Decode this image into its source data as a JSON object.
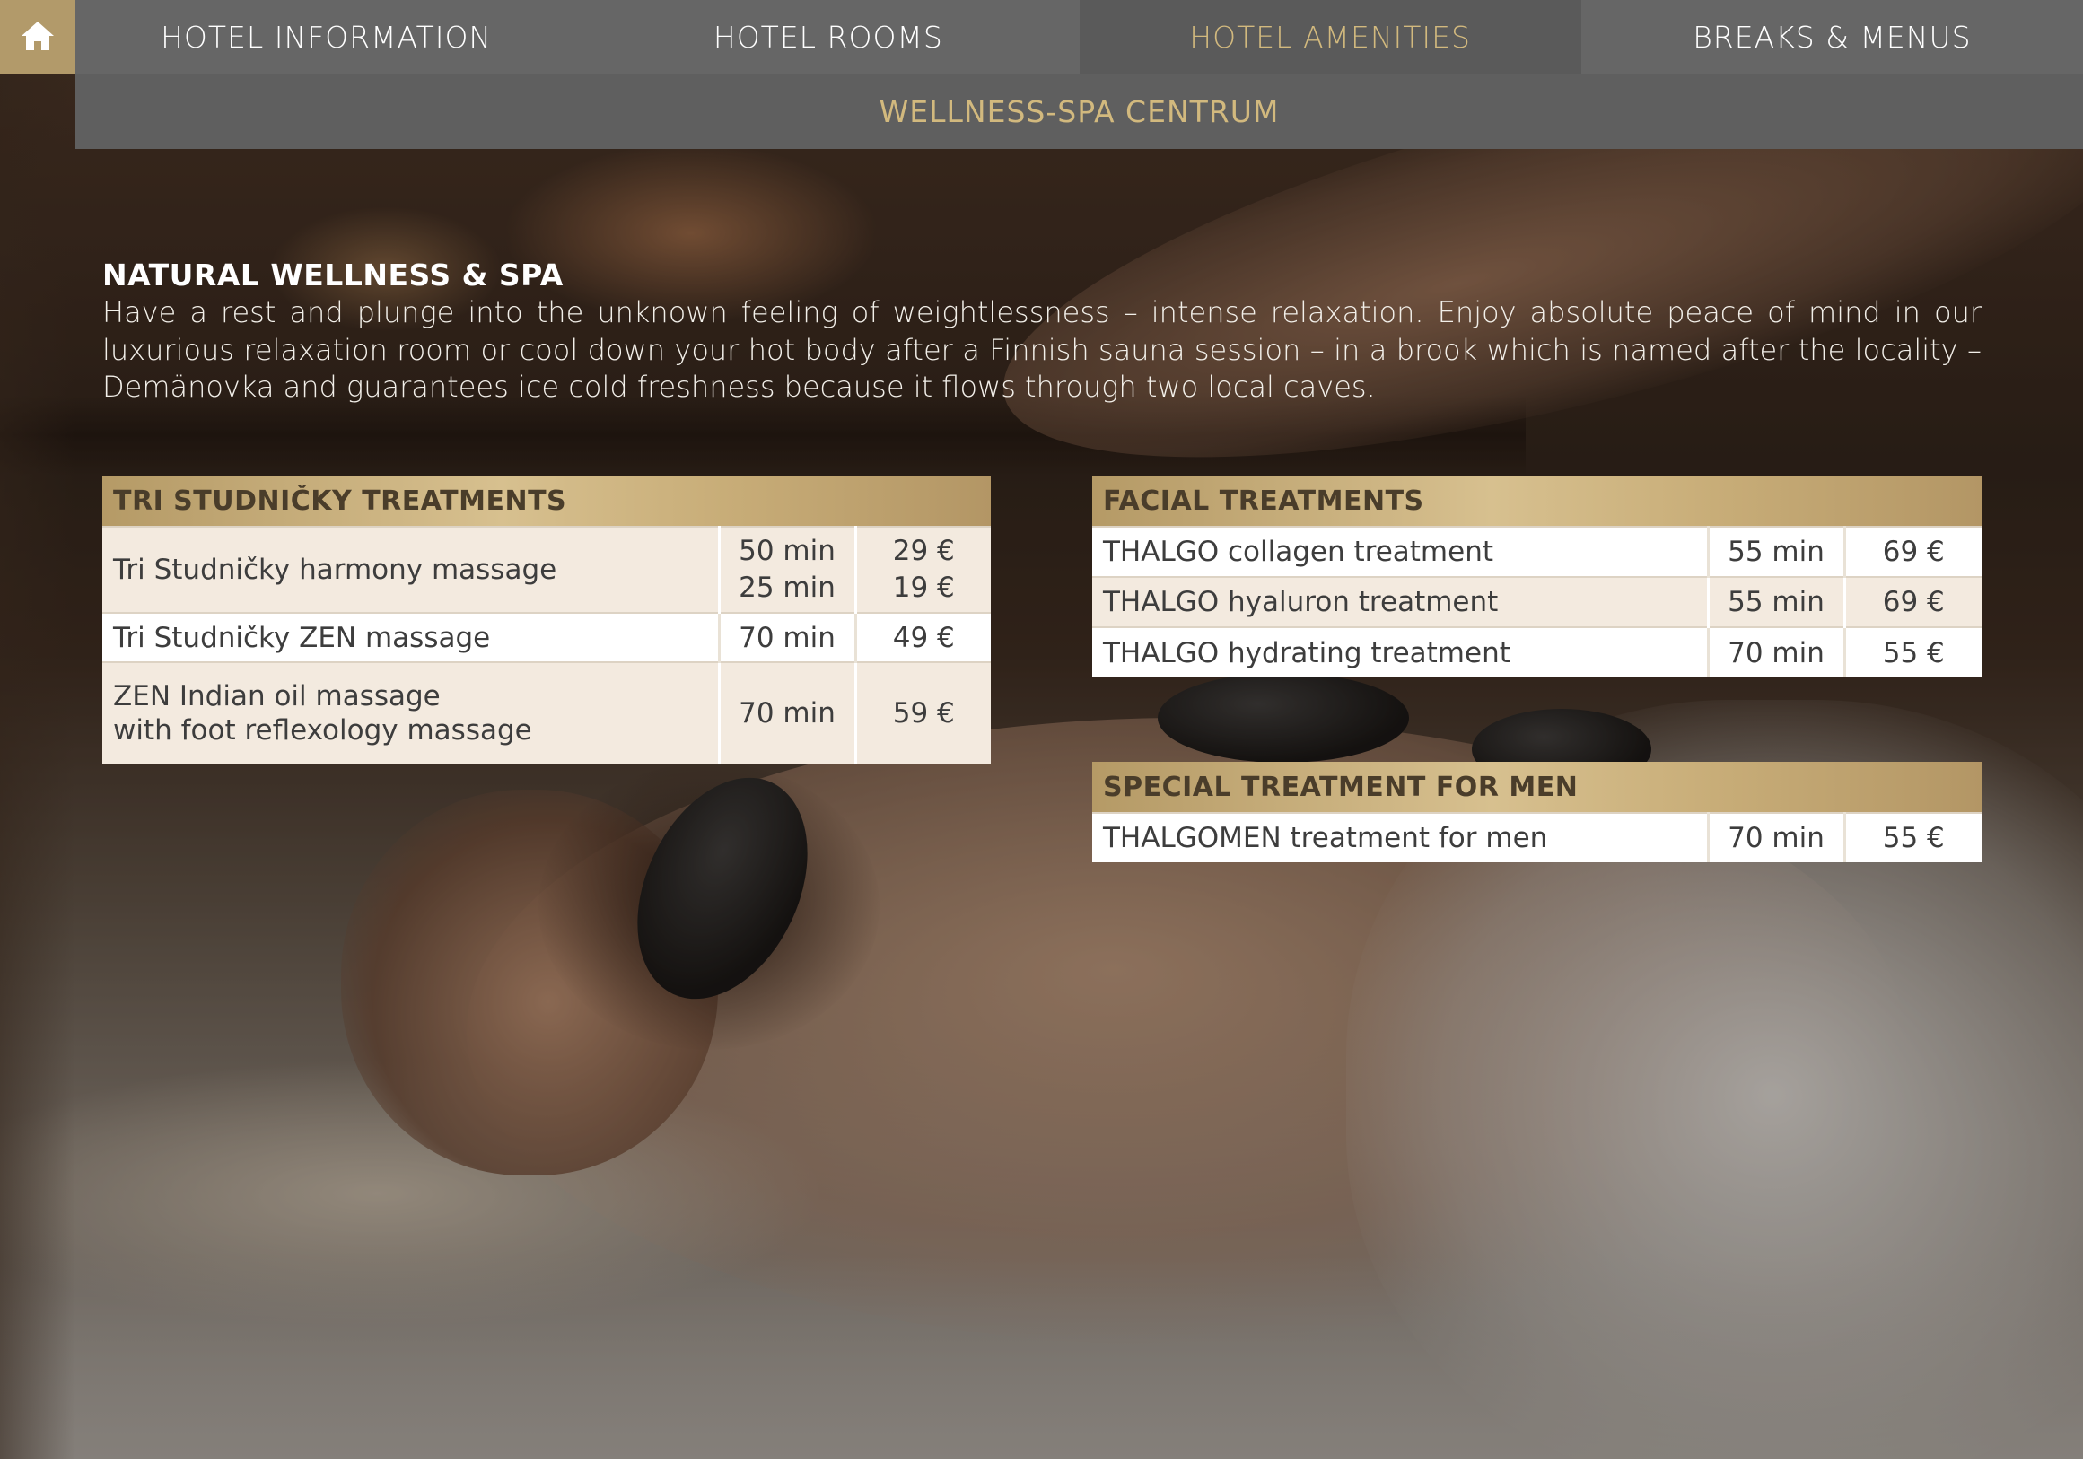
{
  "nav": {
    "home_icon": "home-icon",
    "tabs": [
      {
        "label": "HOTEL INFORMATION",
        "active": false
      },
      {
        "label": "HOTEL ROOMS",
        "active": false
      },
      {
        "label": "HOTEL AMENITIES",
        "active": true
      },
      {
        "label": "BREAKS & MENUS",
        "active": false
      }
    ],
    "sub": "WELLNESS-SPA CENTRUM"
  },
  "colors": {
    "accent_gold": "#b29a6a",
    "nav_gray": "#666666",
    "active_text": "#d2b97e"
  },
  "intro": {
    "title": "NATURAL WELLNESS & SPA",
    "text": "Have a rest and plunge into the unknown feeling of weightlessness – intense relaxation. Enjoy absolute peace of mind in our luxurious relaxation room or cool down your hot body after a Finnish sauna session – in a brook which is named after the locality – Demänovka and guarantees ice cold freshness because it flows through two local caves."
  },
  "tri": {
    "title": "TRI STUDNIČKY TREATMENTS",
    "rows": [
      {
        "name": "Tri Studničky harmony massage",
        "name2": "",
        "dur": "50 min",
        "dur2": "25 min",
        "price": "29 €",
        "price2": "19 €"
      },
      {
        "name": "Tri Studničky ZEN massage",
        "name2": "",
        "dur": "70 min",
        "dur2": "",
        "price": "49 €",
        "price2": ""
      },
      {
        "name": "ZEN Indian oil massage",
        "name2": "with foot reflexology massage",
        "dur": "70 min",
        "dur2": "",
        "price": "59 €",
        "price2": ""
      }
    ]
  },
  "facial": {
    "title": "FACIAL TREATMENTS",
    "rows": [
      {
        "name": "THALGO collagen treatment",
        "dur": "55 min",
        "price": "69 €"
      },
      {
        "name": "THALGO hyaluron treatment",
        "dur": "55 min",
        "price": "69 €"
      },
      {
        "name": "THALGO hydrating treatment",
        "dur": "70 min",
        "price": "55 €"
      }
    ]
  },
  "men": {
    "title": "SPECIAL TREATMENT FOR MEN",
    "rows": [
      {
        "name": "THALGOMEN treatment for men",
        "dur": "70 min",
        "price": "55 €"
      }
    ]
  }
}
